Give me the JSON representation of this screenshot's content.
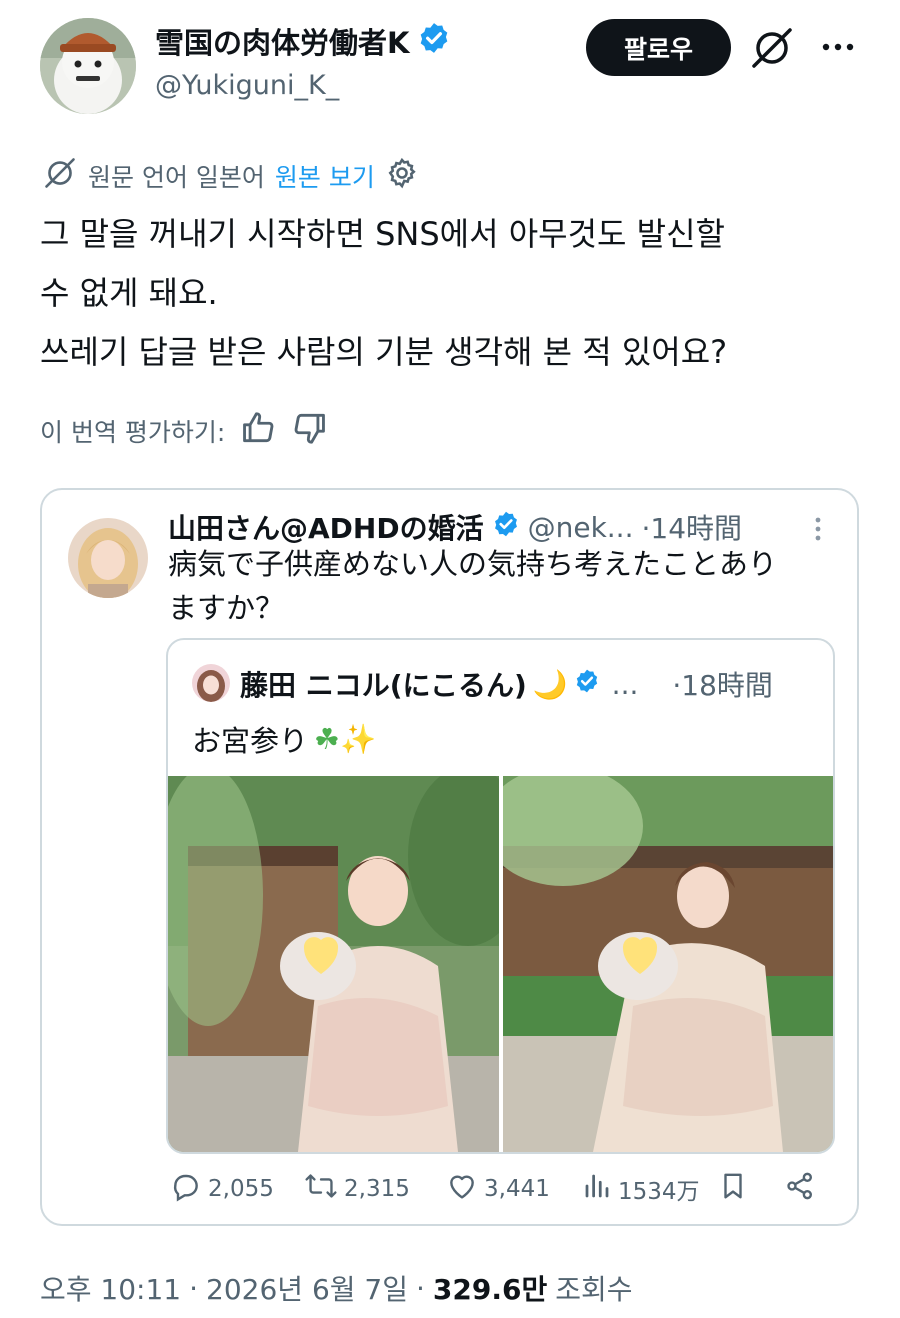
{
  "author": {
    "display_name": "雪国の肉体労働者K",
    "handle": "@Yukiguni_K_",
    "verified": true,
    "verified_color": "#1d9bf0"
  },
  "header": {
    "follow_label": "팔로우",
    "grok_icon": "grok-icon",
    "more_icon": "more-icon"
  },
  "translation": {
    "note": "원문 언어 일본어",
    "show_original": "원본 보기"
  },
  "tweet": {
    "lines": [
      "그 말을 꺼내기 시작하면 SNS에서 아무것도 발신할",
      "수 없게 돼요.",
      "쓰레기 답글 받은 사람의 기분 생각해 본 적 있어요?"
    ],
    "rate_label": "이 번역 평가하기:"
  },
  "quote": {
    "name": "山田さん@ADHDの婚活",
    "handle": "@nek...",
    "time": "·14時間",
    "text_lines": [
      "病気で子供産めない人の気持ち考えたことあり",
      "ますか？"
    ]
  },
  "inner_quote": {
    "name": "藤田 ニコル(にこるん)",
    "moon_emoji": "🌙",
    "dots": "...",
    "time": "·18時間",
    "text": "お宮参り",
    "emojis": "☘✨"
  },
  "actions": {
    "replies": "2,055",
    "reposts": "2,315",
    "likes": "3,441",
    "views": "1534万"
  },
  "meta": {
    "time": "오후 10:11",
    "sep1": "·",
    "date": "2026년 6월 7일",
    "sep2": "·",
    "views_count": "329.6만",
    "views_label": "조회수"
  }
}
